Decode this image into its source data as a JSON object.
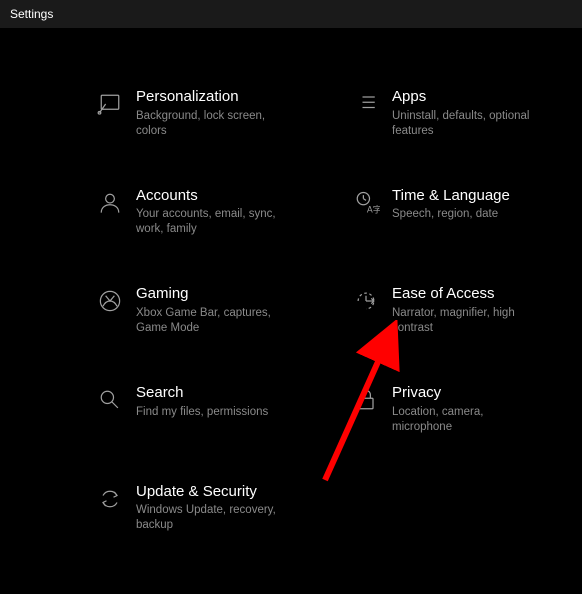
{
  "window": {
    "title": "Settings"
  },
  "items": [
    {
      "title": "Personalization",
      "desc": "Background, lock screen, colors"
    },
    {
      "title": "Apps",
      "desc": "Uninstall, defaults, optional features"
    },
    {
      "title": "Accounts",
      "desc": "Your accounts, email, sync, work, family"
    },
    {
      "title": "Time & Language",
      "desc": "Speech, region, date"
    },
    {
      "title": "Gaming",
      "desc": "Xbox Game Bar, captures, Game Mode"
    },
    {
      "title": "Ease of Access",
      "desc": "Narrator, magnifier, high contrast"
    },
    {
      "title": "Search",
      "desc": "Find my files, permissions"
    },
    {
      "title": "Privacy",
      "desc": "Location, camera, microphone"
    },
    {
      "title": "Update & Security",
      "desc": "Windows Update, recovery, backup"
    }
  ],
  "annotation": {
    "arrow_color": "#ff0000",
    "arrow_target": "ease-of-access"
  }
}
